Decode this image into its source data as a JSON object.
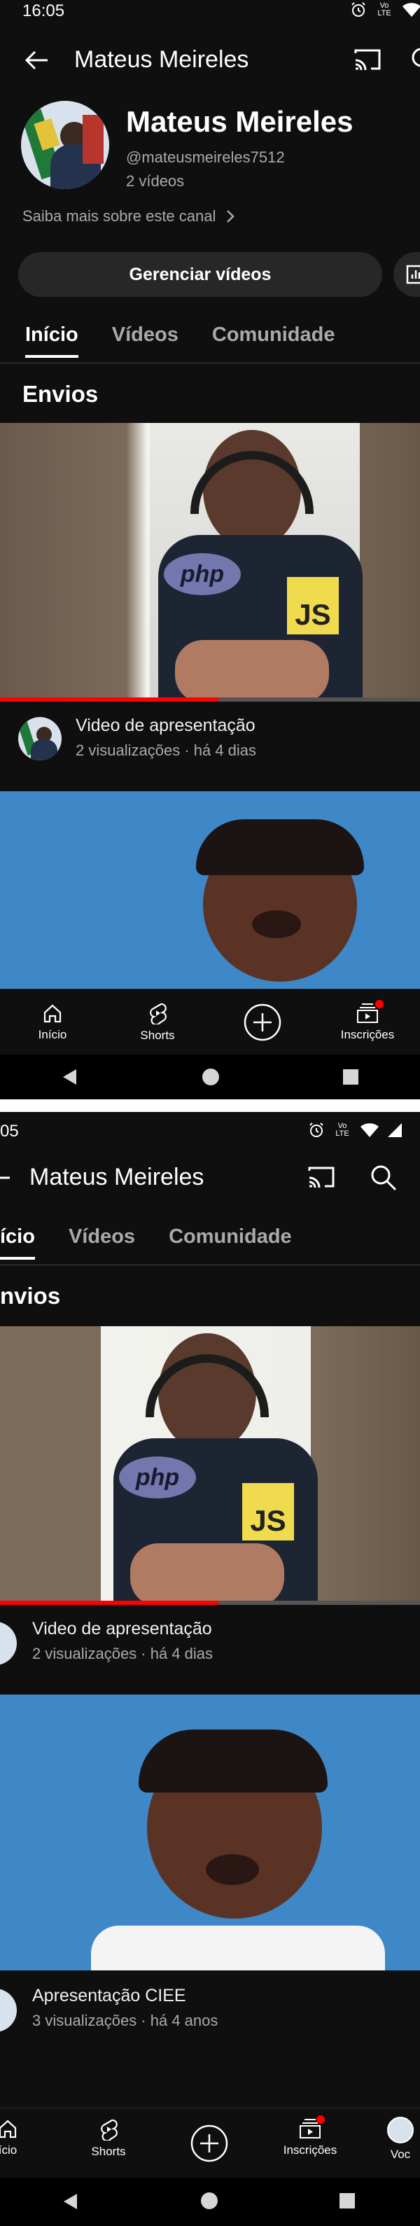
{
  "status_bar": {
    "time": "16:05",
    "time_cropped": "05",
    "network": "Vo LTE"
  },
  "header": {
    "channel_title": "Mateus Meireles"
  },
  "channel": {
    "name": "Mateus Meireles",
    "handle": "@mateusmeireles7512",
    "video_count": "2 vídeos",
    "more_about": "Saiba mais sobre este canal",
    "manage_button": "Gerenciar vídeos"
  },
  "tabs": [
    {
      "label": "Início",
      "label_cropped": "ício",
      "active": true
    },
    {
      "label": "Vídeos",
      "active": false
    },
    {
      "label": "Comunidade",
      "active": false
    }
  ],
  "section": {
    "title": "Envios",
    "title_cropped": "nvios"
  },
  "videos": [
    {
      "title": "Video de apresentação",
      "meta": "2 visualizações · há 4 dias",
      "progress": 0.52,
      "thumb_labels": {
        "php": "php",
        "js": "JS"
      }
    },
    {
      "title": "Apresentação CIEE",
      "meta": "3 visualizações · há 4 anos"
    }
  ],
  "bottom_nav": [
    {
      "label": "Início",
      "label_cropped": "ício",
      "icon": "home-icon"
    },
    {
      "label": "Shorts",
      "icon": "shorts-icon"
    },
    {
      "label": "",
      "icon": "create-plus-icon"
    },
    {
      "label": "Inscrições",
      "icon": "subscriptions-icon",
      "badge": true
    },
    {
      "label": "Voc",
      "icon": "avatar"
    }
  ],
  "colors": {
    "background": "#0f0f0f",
    "accent_red": "#ff0000",
    "secondary_text": "#aaaaaa",
    "chip": "#272727"
  }
}
